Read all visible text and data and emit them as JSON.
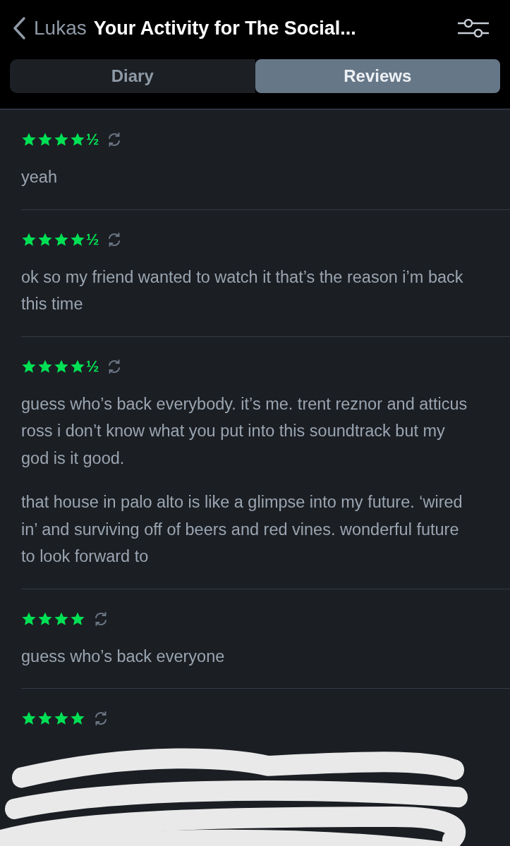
{
  "header": {
    "back_label": "Lukas",
    "title": "Your Activity for The Social..."
  },
  "tabs": [
    {
      "label": "Diary",
      "selected": false
    },
    {
      "label": "Reviews",
      "selected": true
    }
  ],
  "reviews": [
    {
      "stars": 4,
      "half": "½",
      "rewatch": true,
      "redacted": false,
      "paragraphs": [
        "yeah"
      ]
    },
    {
      "stars": 4,
      "half": "½",
      "rewatch": true,
      "redacted": false,
      "paragraphs": [
        "ok so my friend wanted to watch it that’s the reason i’m back this time"
      ]
    },
    {
      "stars": 4,
      "half": "½",
      "rewatch": true,
      "redacted": false,
      "paragraphs": [
        "guess who’s back everybody. it’s me. trent reznor and atticus ross i don’t know what you put into this soundtrack but my god is it good.",
        "that house in palo alto is like a glimpse into my future. ‘wired in’ and surviving off of beers and red vines. wonderful future to look forward to"
      ]
    },
    {
      "stars": 4,
      "rewatch": true,
      "redacted": false,
      "paragraphs": [
        "guess who’s back everyone"
      ]
    },
    {
      "stars": 4,
      "rewatch": true,
      "redacted": true
    }
  ]
}
